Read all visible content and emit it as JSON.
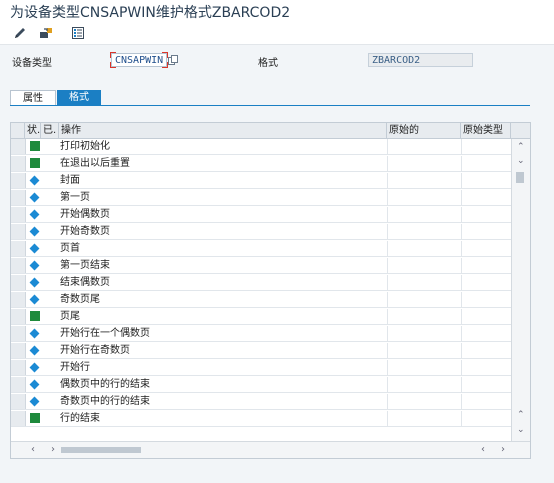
{
  "window": {
    "title": "为设备类型CNSAPWIN维护格式ZBARCOD2"
  },
  "toolbar": {
    "buttons": [
      {
        "icon": "pencil-icon"
      },
      {
        "icon": "transport-icon"
      },
      {
        "icon": "list-icon"
      }
    ]
  },
  "fields": {
    "device_type_label": "设备类型",
    "device_type_value": "CNSAPWIN",
    "format_label": "格式",
    "format_value": "ZBARCOD2"
  },
  "tabs": [
    {
      "label": "属性",
      "active": false
    },
    {
      "label": "格式",
      "active": true
    }
  ],
  "grid": {
    "columns": [
      "状.",
      "已.",
      "操作",
      "原始的",
      "原始类型"
    ],
    "rows": [
      {
        "icon": "green-square",
        "label": "打印初始化"
      },
      {
        "icon": "green-square",
        "label": "在退出以后重置"
      },
      {
        "icon": "blue-diamond",
        "label": "封面"
      },
      {
        "icon": "blue-diamond",
        "label": "第一页"
      },
      {
        "icon": "blue-diamond",
        "label": "开始偶数页"
      },
      {
        "icon": "blue-diamond",
        "label": "开始奇数页"
      },
      {
        "icon": "blue-diamond",
        "label": "页首"
      },
      {
        "icon": "blue-diamond",
        "label": "第一页结束"
      },
      {
        "icon": "blue-diamond",
        "label": "结束偶数页"
      },
      {
        "icon": "blue-diamond",
        "label": "奇数页尾"
      },
      {
        "icon": "green-square",
        "label": "页尾"
      },
      {
        "icon": "blue-diamond",
        "label": "开始行在一个偶数页"
      },
      {
        "icon": "blue-diamond",
        "label": "开始行在奇数页"
      },
      {
        "icon": "blue-diamond",
        "label": "开始行"
      },
      {
        "icon": "blue-diamond",
        "label": "偶数页中的行的结束"
      },
      {
        "icon": "blue-diamond",
        "label": "奇数页中的行的结束"
      },
      {
        "icon": "green-square",
        "label": "行的结束"
      }
    ]
  },
  "colors": {
    "accent": "#1b7fc4",
    "green_status": "#1e8a3c",
    "blue_status": "#1b8ad4"
  }
}
